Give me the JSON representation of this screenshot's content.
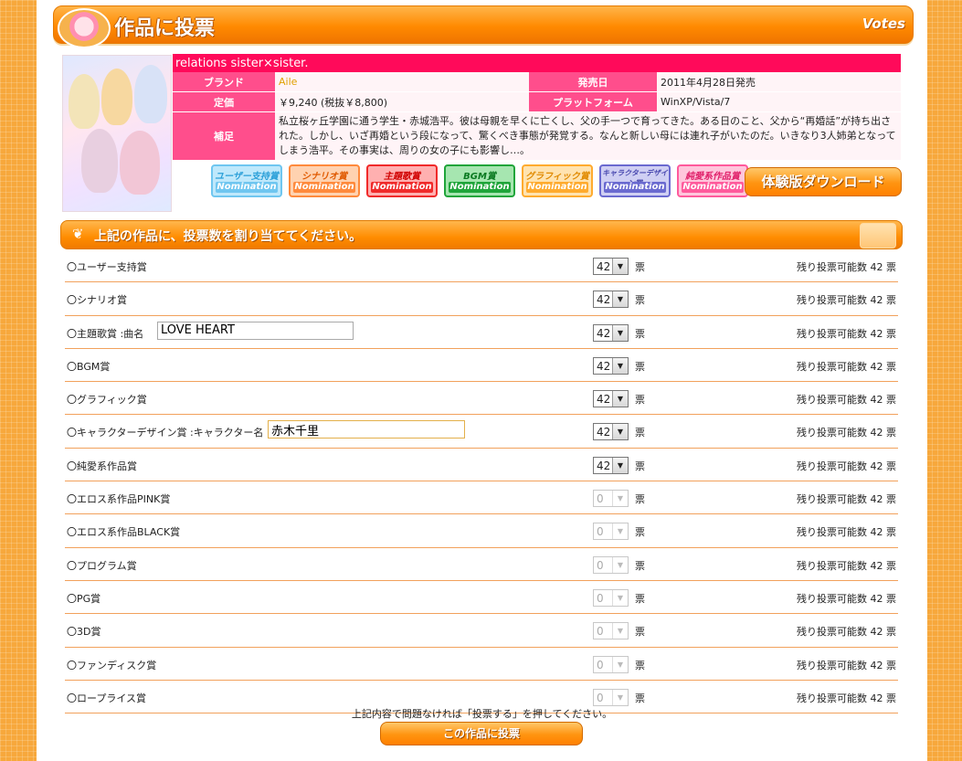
{
  "header": {
    "title": "作品に投票",
    "votes_label": "Votes"
  },
  "product": {
    "title": "relations sister×sister.",
    "brand_label": "ブランド",
    "brand": "Aile",
    "release_label": "発売日",
    "release": "2011年4月28日発売",
    "price_label": "定価",
    "price": "￥9,240 (税抜￥8,800)",
    "platform_label": "プラットフォーム",
    "platform": "WinXP/Vista/7",
    "note_label": "補足",
    "note": "私立桜ヶ丘学園に通う学生・赤城浩平。彼は母親を早くに亡くし、父の手一つで育ってきた。ある日のこと、父から“再婚話”が持ち出された。しかし、いざ再婚という段になって、驚くべき事態が発覚する。なんと新しい母には連れ子がいたのだ。いきなり3人姉弟となってしまう浩平。その事実は、周りの女の子にも影響し…。"
  },
  "nominations": [
    {
      "label": "ユーザー支持賞",
      "sub": "Nomination",
      "color": "#6fc6f0"
    },
    {
      "label": "シナリオ賞",
      "sub": "Nomination",
      "color": "#ff8a3c"
    },
    {
      "label": "主題歌賞",
      "sub": "Nomination",
      "color": "#f02a2a"
    },
    {
      "label": "BGM賞",
      "sub": "Nomination",
      "color": "#1fa53a"
    },
    {
      "label": "グラフィック賞",
      "sub": "Nomination",
      "color": "#ffab2e"
    },
    {
      "label": "キャラクターデザイン賞",
      "sub": "Nomination",
      "color": "#6a6ad0"
    },
    {
      "label": "純愛系作品賞",
      "sub": "Nomination",
      "color": "#ff5a9c"
    }
  ],
  "trial_download": "体験版ダウンロード",
  "section_title": "上記の作品に、投票数を割り当ててください。",
  "unit": "票",
  "remain_label": "残り投票可能数 42 票",
  "vote_rows": [
    {
      "name": "〇ユーザー支持賞",
      "value": "42",
      "enabled": true
    },
    {
      "name": "〇シナリオ賞",
      "value": "42",
      "enabled": true
    },
    {
      "name": "〇主題歌賞 :曲名",
      "value": "42",
      "enabled": true,
      "input": "LOVE HEART"
    },
    {
      "name": "〇BGM賞",
      "value": "42",
      "enabled": true
    },
    {
      "name": "〇グラフィック賞",
      "value": "42",
      "enabled": true
    },
    {
      "name": "〇キャラクターデザイン賞 :キャラクター名",
      "value": "42",
      "enabled": true,
      "input": "赤木千里"
    },
    {
      "name": "〇純愛系作品賞",
      "value": "42",
      "enabled": true
    },
    {
      "name": "〇エロス系作品PINK賞",
      "value": "0",
      "enabled": false
    },
    {
      "name": "〇エロス系作品BLACK賞",
      "value": "0",
      "enabled": false
    },
    {
      "name": "〇プログラム賞",
      "value": "0",
      "enabled": false
    },
    {
      "name": "〇PG賞",
      "value": "0",
      "enabled": false
    },
    {
      "name": "〇3D賞",
      "value": "0",
      "enabled": false
    },
    {
      "name": "〇ファンディスク賞",
      "value": "0",
      "enabled": false
    },
    {
      "name": "〇ロープライス賞",
      "value": "0",
      "enabled": false
    }
  ],
  "confirm_text": "上記内容で問題なければ「投票する」を押してください。",
  "submit_label": "この作品に投票"
}
